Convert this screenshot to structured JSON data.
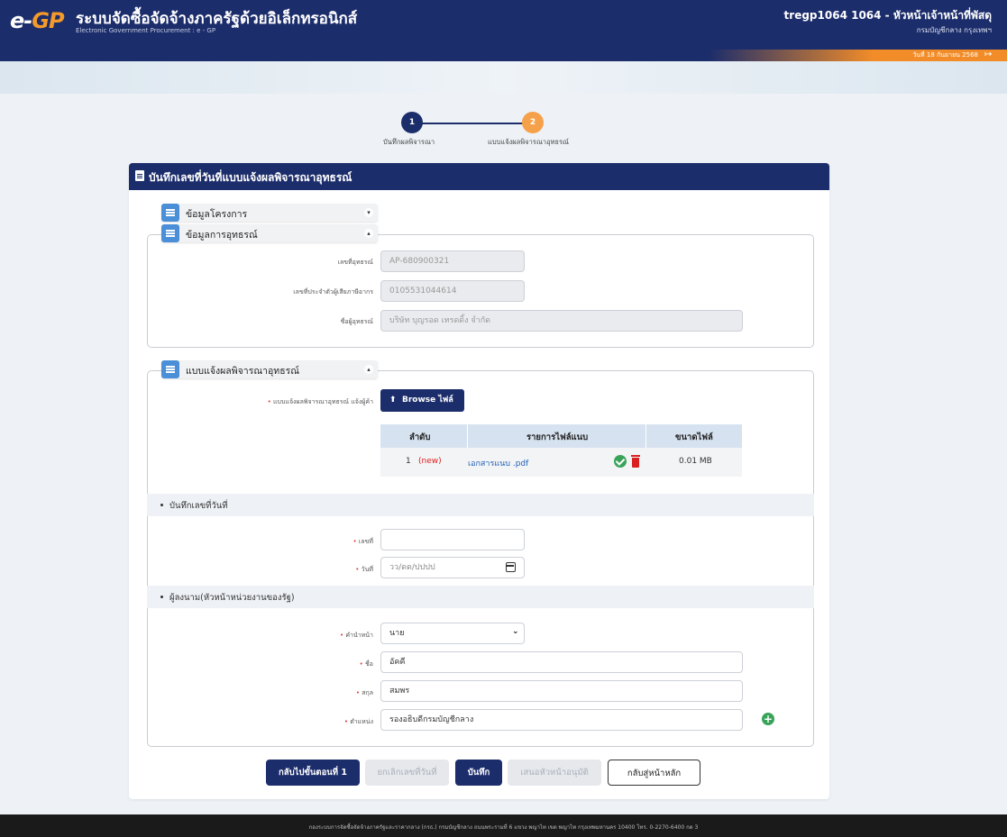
{
  "header": {
    "logo_e": "e-",
    "logo_gp": "GP",
    "title": "ระบบจัดซื้อจัดจ้างภาครัฐด้วยอิเล็กทรอนิกส์",
    "subtitle": "Electronic Government Procurement : e - GP",
    "user_name": "tregp1064 1064 - หัวหน้าเจ้าหน้าที่พัสดุ",
    "user_org": "กรมบัญชีกลาง กรุงเทพฯ",
    "date": "วันที่ 18 กันยายน 2568",
    "icons": {
      "logout": "logout-icon"
    },
    "colors": {
      "navy": "#1c2d6b",
      "orange": "#f39a2b"
    }
  },
  "stepper": {
    "steps": [
      {
        "number": "1",
        "label": "บันทึกผลพิจารณา"
      },
      {
        "number": "2",
        "label": "แบบแจ้งผลพิจารณาอุทธรณ์"
      }
    ]
  },
  "card": {
    "title": "บันทึกเลขที่วันที่แบบแจ้งผลพิจารณาอุทธรณ์",
    "sections": {
      "project": {
        "label": "ข้อมูลโครงการ"
      },
      "appeal": {
        "label": "ข้อมูลการอุทธรณ์",
        "fields": [
          {
            "label": "เลขที่อุทธรณ์",
            "value": "AP-680900321"
          },
          {
            "label": "เลขที่ประจำตัวผู้เสียภาษีอากร",
            "value": "0105531044614"
          },
          {
            "label": "ชื่อผู้อุทธรณ์",
            "value": "บริษัท บุญรอด เทรดดิ้ง จำกัด"
          }
        ]
      },
      "notice": {
        "label": "แบบแจ้งผลพิจารณาอุทธรณ์",
        "upload_label": "แบบแจ้งผลพิจารณาอุทธรณ์ แจ้งผู้ค้า",
        "browse_button": "Browse ไฟล์",
        "table": {
          "headers": [
            "ลำดับ",
            "รายการไฟล์แนบ",
            "ขนาดไฟล์"
          ],
          "rows": [
            {
              "no": "1",
              "tag": "(new)",
              "name": "เอกสารแนบ .pdf",
              "size": "0.01 MB"
            }
          ]
        }
      },
      "record": {
        "label": "บันทึกเลขที่วันที่",
        "number_label": "เลขที่",
        "number_value": "",
        "date_label": "วันที่",
        "date_placeholder": "วว/ดด/ปปปป"
      },
      "signer": {
        "label": "ผู้ลงนาม(หัวหน้าหน่วยงานของรัฐ)",
        "prefix_label": "คำนำหน้า",
        "prefix_value": "นาย",
        "first_label": "ชื่อ",
        "first_value": "อัคคี",
        "last_label": "สกุล",
        "last_value": "สมพร",
        "position_label": "ตำแหน่ง",
        "position_value": "รองอธิบดีกรมบัญชีกลาง"
      }
    }
  },
  "buttons": {
    "back_step1": "กลับไปขั้นตอนที่ 1",
    "cancel_record": "ยกเลิกเลขที่วันที่",
    "save": "บันทึก",
    "propose": "เสนอหัวหน้าอนุมัติ",
    "home": "กลับสู่หน้าหลัก"
  },
  "footer": {
    "text": "กองระบบการจัดซื้อจัดจ้างภาครัฐและราคากลาง (กรธ.) กรมบัญชีกลาง ถนนพระรามที่ 6 แขวง พญาไท เขต พญาไท กรุงเทพมหานคร 10400 โทร. 0-2270-6400 กด 3"
  }
}
